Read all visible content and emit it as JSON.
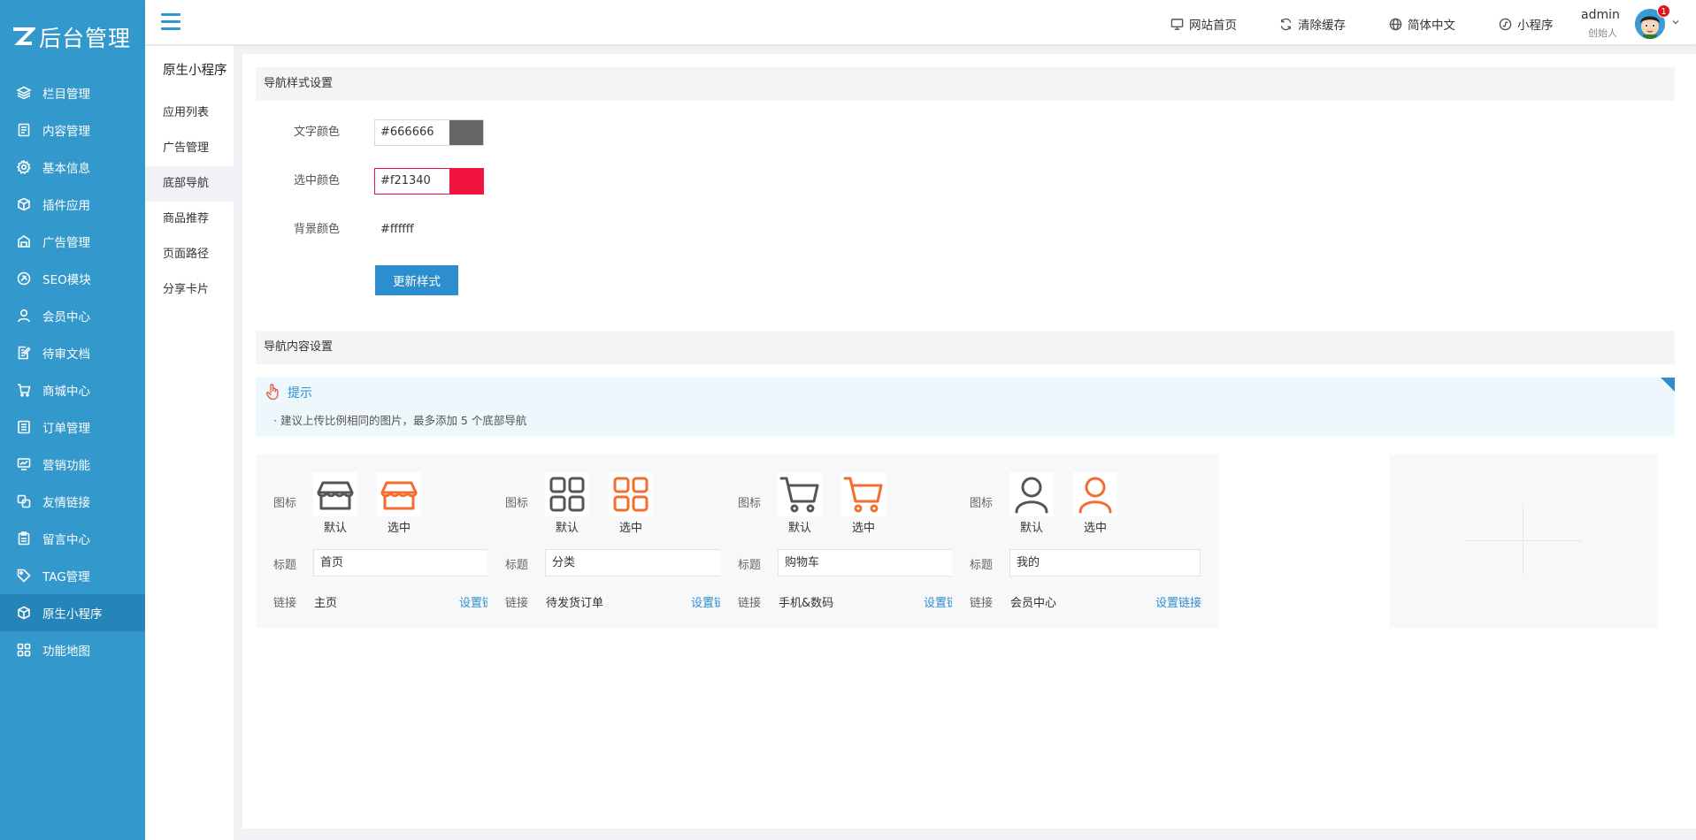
{
  "brand": {
    "logo_text": "后台管理"
  },
  "sidebar": {
    "items": [
      {
        "label": "栏目管理",
        "icon": "layers-icon"
      },
      {
        "label": "内容管理",
        "icon": "document-icon"
      },
      {
        "label": "基本信息",
        "icon": "gear-icon"
      },
      {
        "label": "插件应用",
        "icon": "cube-icon"
      },
      {
        "label": "广告管理",
        "icon": "ad-icon"
      },
      {
        "label": "SEO模块",
        "icon": "seo-icon"
      },
      {
        "label": "会员中心",
        "icon": "user-icon"
      },
      {
        "label": "待审文档",
        "icon": "edit-doc-icon"
      },
      {
        "label": "商城中心",
        "icon": "cart-icon"
      },
      {
        "label": "订单管理",
        "icon": "list-icon"
      },
      {
        "label": "营销功能",
        "icon": "chart-icon"
      },
      {
        "label": "友情链接",
        "icon": "link-icon"
      },
      {
        "label": "留言中心",
        "icon": "clipboard-icon"
      },
      {
        "label": "TAG管理",
        "icon": "tag-icon"
      },
      {
        "label": "原生小程序",
        "icon": "cube-icon",
        "active": true
      },
      {
        "label": "功能地图",
        "icon": "grid-icon"
      }
    ]
  },
  "header": {
    "links": [
      {
        "label": "网站首页",
        "icon": "monitor-icon"
      },
      {
        "label": "清除缓存",
        "icon": "refresh-icon"
      },
      {
        "label": "简体中文",
        "icon": "globe-icon"
      },
      {
        "label": "小程序",
        "icon": "miniprogram-icon"
      }
    ],
    "user": {
      "name": "admin",
      "role": "创始人",
      "badge": "1"
    }
  },
  "submenu": {
    "title": "原生小程序",
    "items": [
      {
        "label": "应用列表"
      },
      {
        "label": "广告管理"
      },
      {
        "label": "底部导航",
        "active": true
      },
      {
        "label": "商品推荐"
      },
      {
        "label": "页面路径"
      },
      {
        "label": "分享卡片"
      }
    ]
  },
  "style_section": {
    "heading": "导航样式设置",
    "text_color": {
      "label": "文字颜色",
      "value": "#666666"
    },
    "active_color": {
      "label": "选中颜色",
      "value": "#f21340"
    },
    "bg_color": {
      "label": "背景颜色",
      "value": "#ffffff"
    },
    "update_button": "更新样式"
  },
  "content_section": {
    "heading": "导航内容设置",
    "tip_title": "提示",
    "tip_text": "· 建议上传比例相同的图片，最多添加 5 个底部导航",
    "labels": {
      "icon": "图标",
      "default": "默认",
      "selected": "选中",
      "title": "标题",
      "link": "链接",
      "set_link": "设置链接"
    },
    "colors": {
      "default_icon": "#555555",
      "selected_icon": "#f36d2e"
    },
    "cards": [
      {
        "icon": "store-icon",
        "title": "首页",
        "link": "主页"
      },
      {
        "icon": "grid-icon",
        "title": "分类",
        "link": "待发货订单"
      },
      {
        "icon": "cart-icon",
        "title": "购物车",
        "link": "手机&数码"
      },
      {
        "icon": "user-icon",
        "title": "我的",
        "link": "会员中心"
      }
    ]
  }
}
